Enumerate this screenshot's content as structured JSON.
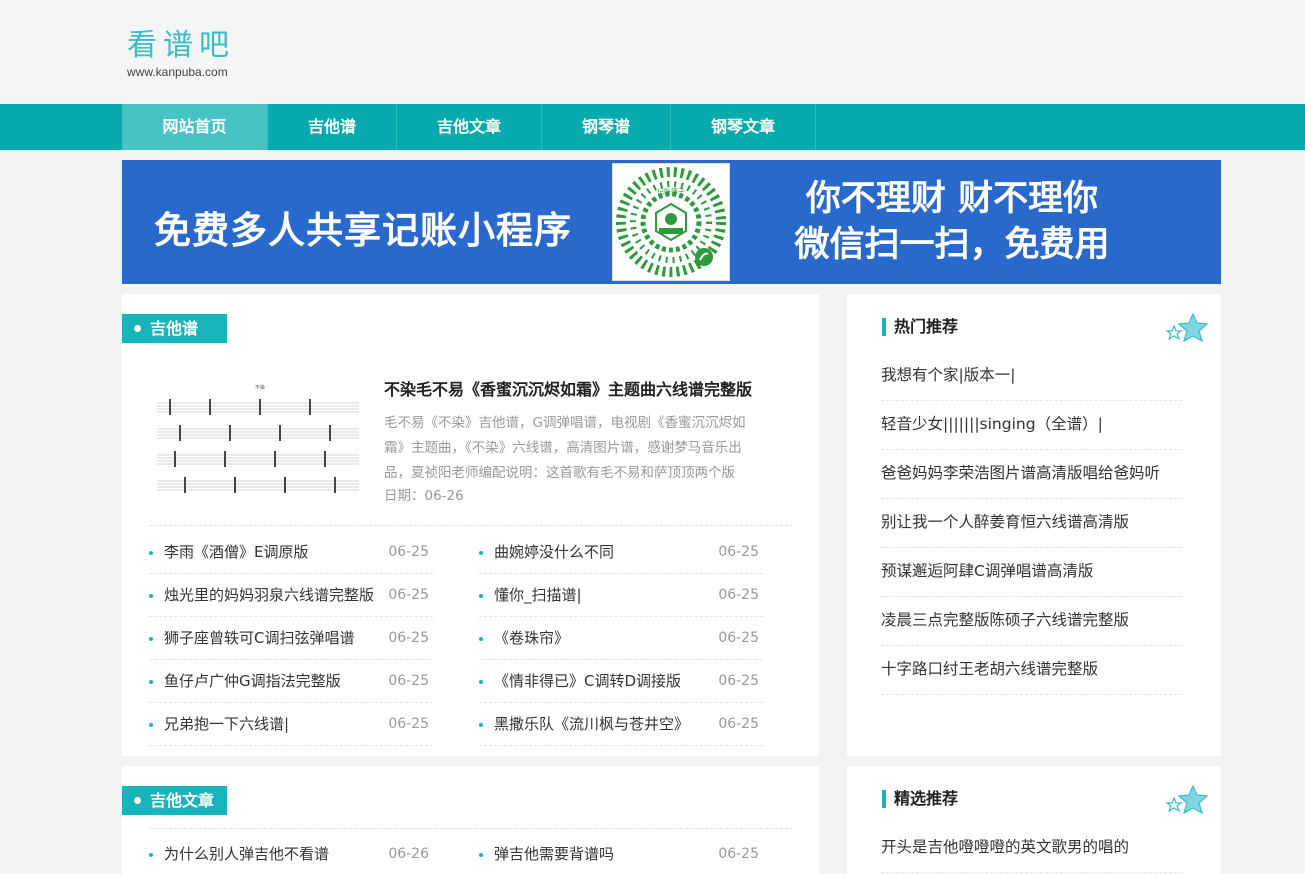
{
  "site": {
    "logo_cn": "看谱吧",
    "logo_url": "www.kanpuba.com"
  },
  "nav": {
    "items": [
      {
        "label": "网站首页",
        "active": true
      },
      {
        "label": "吉他谱",
        "active": false
      },
      {
        "label": "吉他文章",
        "active": false
      },
      {
        "label": "钢琴谱",
        "active": false
      },
      {
        "label": "钢琴文章",
        "active": false
      }
    ]
  },
  "banner": {
    "left_text": "免费多人共享记账小程序",
    "right_line1": "你不理财 财不理你",
    "right_line2": "微信扫一扫，免费用",
    "qr_label": "记账簿子",
    "bg_color": "#2a69cc"
  },
  "guitar_tabs": {
    "section_label": "吉他谱",
    "featured": {
      "title": "不染毛不易《香蜜沉沉烬如霜》主题曲六线谱完整版",
      "description": "毛不易《不染》吉他谱，G调弹唱谱，电视剧《香蜜沉沉烬如霜》主题曲，《不染》六线谱，高清图片谱，感谢梦马音乐出品，夏祯阳老师编配说明：这首歌有毛不易和萨顶顶两个版",
      "date": "日期：06-26"
    },
    "left_list": [
      {
        "title": "李雨《酒僧》E调原版",
        "date": "06-25"
      },
      {
        "title": "烛光里的妈妈羽泉六线谱完整版",
        "date": "06-25"
      },
      {
        "title": "狮子座曾轶可C调扫弦弹唱谱",
        "date": "06-25"
      },
      {
        "title": "鱼仔卢广仲G调指法完整版",
        "date": "06-25"
      },
      {
        "title": "兄弟抱一下六线谱|",
        "date": "06-25"
      }
    ],
    "right_list": [
      {
        "title": "曲婉婷没什么不同",
        "date": "06-25"
      },
      {
        "title": "懂你_扫描谱|",
        "date": "06-25"
      },
      {
        "title": "《卷珠帘》",
        "date": "06-25"
      },
      {
        "title": "《情非得已》C调转D调接版",
        "date": "06-25"
      },
      {
        "title": "黑撒乐队《流川枫与苍井空》",
        "date": "06-25"
      }
    ]
  },
  "guitar_articles": {
    "section_label": "吉他文章",
    "left_list": [
      {
        "title": "为什么别人弹吉他不看谱",
        "date": "06-26"
      }
    ],
    "right_list": [
      {
        "title": "弹吉他需要背谱吗",
        "date": "06-25"
      }
    ]
  },
  "hot": {
    "title": "热门推荐",
    "items": [
      "我想有个家|版本一|",
      "轻音少女|||||||singing（全谱）|",
      "爸爸妈妈李荣浩图片谱高清版唱给爸妈听",
      "别让我一个人醉姜育恒六线谱高清版",
      "预谋邂逅阿肆C调弹唱谱高清版",
      "凌晨三点完整版陈硕子六线谱完整版",
      "十字路口纣王老胡六线谱完整版"
    ]
  },
  "selected": {
    "title": "精选推荐",
    "items": [
      "开头是吉他噔噔噔的英文歌男的唱的"
    ]
  },
  "colors": {
    "accent": "#07abae",
    "tag": "#17b5b9"
  }
}
